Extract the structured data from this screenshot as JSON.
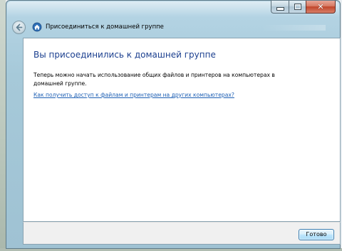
{
  "window": {
    "title": "Присоединиться к домашней группе",
    "caption_buttons": {
      "minimize_icon": "minimize-icon",
      "maximize_icon": "maximize-icon",
      "close_icon": "close-icon",
      "close_glyph": "✕"
    },
    "back_icon": "back-arrow-icon",
    "app_icon": "homegroup-icon"
  },
  "main": {
    "heading": "Вы присоединились к домашней группе",
    "description": "Теперь можно начать использование общих файлов и принтеров на компьютерах в домашней группе.",
    "help_link": "Как получить доступ к файлам и принтерам на других компьютерах?"
  },
  "footer": {
    "done_label": "Готово"
  },
  "colors": {
    "heading": "#1b3f8f",
    "link": "#1d5fb4",
    "frame": "#a6c9d9",
    "close_button": "#c0452a"
  }
}
